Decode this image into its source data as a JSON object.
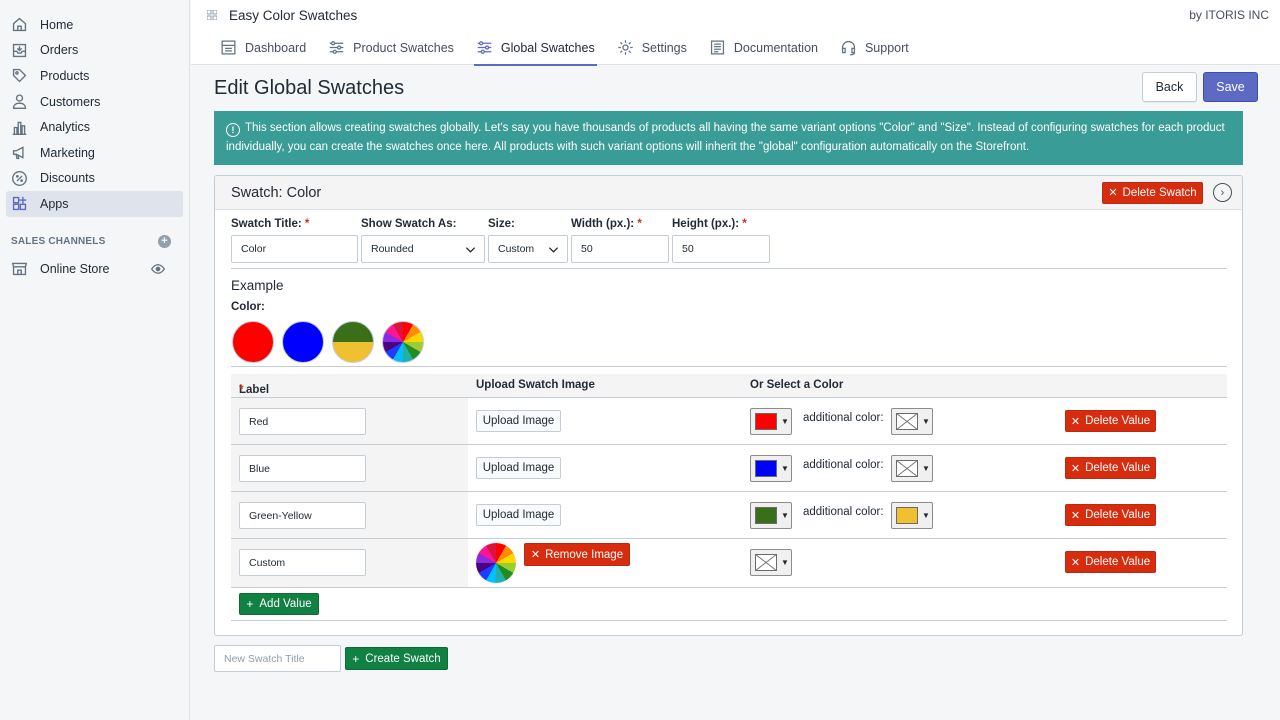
{
  "sidebar": {
    "items": [
      {
        "label": "Home",
        "icon": "home-icon"
      },
      {
        "label": "Orders",
        "icon": "orders-icon"
      },
      {
        "label": "Products",
        "icon": "tag-icon"
      },
      {
        "label": "Customers",
        "icon": "person-icon"
      },
      {
        "label": "Analytics",
        "icon": "bar-chart-icon"
      },
      {
        "label": "Marketing",
        "icon": "megaphone-icon"
      },
      {
        "label": "Discounts",
        "icon": "discount-icon"
      },
      {
        "label": "Apps",
        "icon": "apps-icon",
        "active": true
      }
    ],
    "sales_channels_heading": "SALES CHANNELS",
    "online_store": "Online Store"
  },
  "header": {
    "app_title": "Easy Color Swatches",
    "byline": "by ITORIS INC"
  },
  "tabs": [
    {
      "label": "Dashboard"
    },
    {
      "label": "Product Swatches"
    },
    {
      "label": "Global Swatches",
      "active": true
    },
    {
      "label": "Settings"
    },
    {
      "label": "Documentation"
    },
    {
      "label": "Support"
    }
  ],
  "page": {
    "title": "Edit Global Swatches",
    "back_label": "Back",
    "save_label": "Save",
    "info_text": "This section allows creating swatches globally. Let's say you have thousands of products all having the same variant options \"Color\" and \"Size\". Instead of configuring swatches for each product individually, you can create the swatches once here. All products with such variant options will inherit the \"global\" configuration automatically on the Storefront."
  },
  "swatch": {
    "heading": "Swatch: Color",
    "delete_swatch_label": "Delete Swatch",
    "fields": {
      "title_label": "Swatch Title:",
      "title_value": "Color",
      "show_as_label": "Show Swatch As:",
      "show_as_value": "Rounded",
      "size_label": "Size:",
      "size_value": "Custom",
      "width_label": "Width (px.):",
      "width_value": "50",
      "height_label": "Height (px.):",
      "height_value": "50",
      "required_mark": "*"
    },
    "example": {
      "title": "Example",
      "color_label": "Color:"
    },
    "table": {
      "col_label": "Label",
      "col_upload": "Upload Swatch Image",
      "col_color": "Or Select a Color"
    },
    "rows": [
      {
        "label": "Red",
        "upload": "Upload Image",
        "color": "#ff0000",
        "additional_label": "additional color:",
        "additional": "none",
        "delete": "Delete Value"
      },
      {
        "label": "Blue",
        "upload": "Upload Image",
        "color": "#0000ff",
        "additional_label": "additional color:",
        "additional": "none",
        "delete": "Delete Value"
      },
      {
        "label": "Green-Yellow",
        "upload": "Upload Image",
        "color": "#3a6f1a",
        "additional_label": "additional color:",
        "additional": "#f0c030",
        "delete": "Delete Value"
      },
      {
        "label": "Custom",
        "remove_image": "Remove Image",
        "color": "none",
        "delete": "Delete Value"
      }
    ],
    "add_value_label": "Add Value"
  },
  "new_swatch": {
    "placeholder": "New Swatch Title",
    "create_label": "Create Swatch"
  },
  "colors": {
    "accent": "#5c6ac4",
    "info_bg": "#3a9c96",
    "danger": "#d72c0d",
    "success": "#108043"
  }
}
